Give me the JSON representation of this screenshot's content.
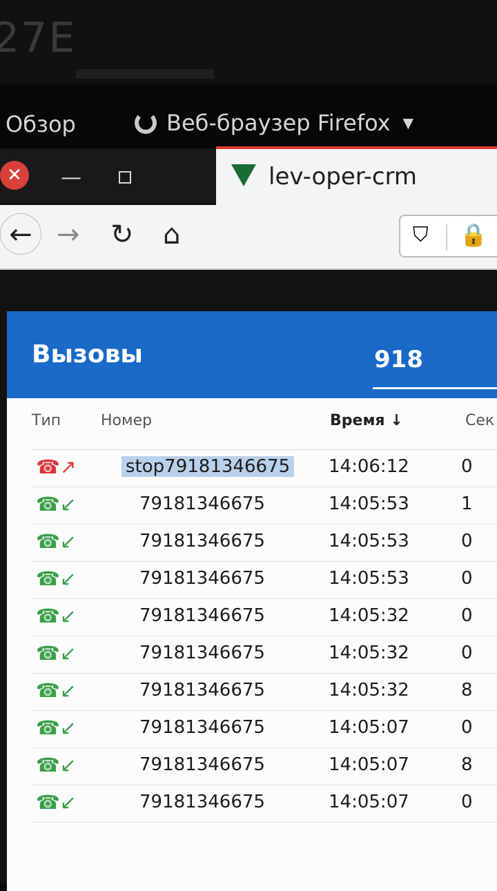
{
  "desktop": {
    "background_text": "27E"
  },
  "topbar": {
    "overview": "Обзор",
    "app_name": "Веб-браузер Firefox"
  },
  "tab": {
    "title": "lev-oper-crm"
  },
  "calls_widget": {
    "title": "Вызовы",
    "counter": "918",
    "columns": {
      "type": "Тип",
      "number": "Номер",
      "time": "Время",
      "seconds": "Сек"
    },
    "rows": [
      {
        "direction": "outgoing",
        "number": "stop79181346675",
        "time": "14:06:12",
        "seconds": "0"
      },
      {
        "direction": "incoming",
        "number": "79181346675",
        "time": "14:05:53",
        "seconds": "1"
      },
      {
        "direction": "incoming",
        "number": "79181346675",
        "time": "14:05:53",
        "seconds": "0"
      },
      {
        "direction": "incoming",
        "number": "79181346675",
        "time": "14:05:53",
        "seconds": "0"
      },
      {
        "direction": "incoming",
        "number": "79181346675",
        "time": "14:05:32",
        "seconds": "0"
      },
      {
        "direction": "incoming",
        "number": "79181346675",
        "time": "14:05:32",
        "seconds": "0"
      },
      {
        "direction": "incoming",
        "number": "79181346675",
        "time": "14:05:32",
        "seconds": "8"
      },
      {
        "direction": "incoming",
        "number": "79181346675",
        "time": "14:05:07",
        "seconds": "0"
      },
      {
        "direction": "incoming",
        "number": "79181346675",
        "time": "14:05:07",
        "seconds": "8"
      },
      {
        "direction": "incoming",
        "number": "79181346675",
        "time": "14:05:07",
        "seconds": "0"
      }
    ]
  },
  "colors": {
    "header_blue": "#1969c8",
    "incoming_green": "#3aa048",
    "outgoing_red": "#d8383c",
    "close_red": "#d9403a"
  }
}
